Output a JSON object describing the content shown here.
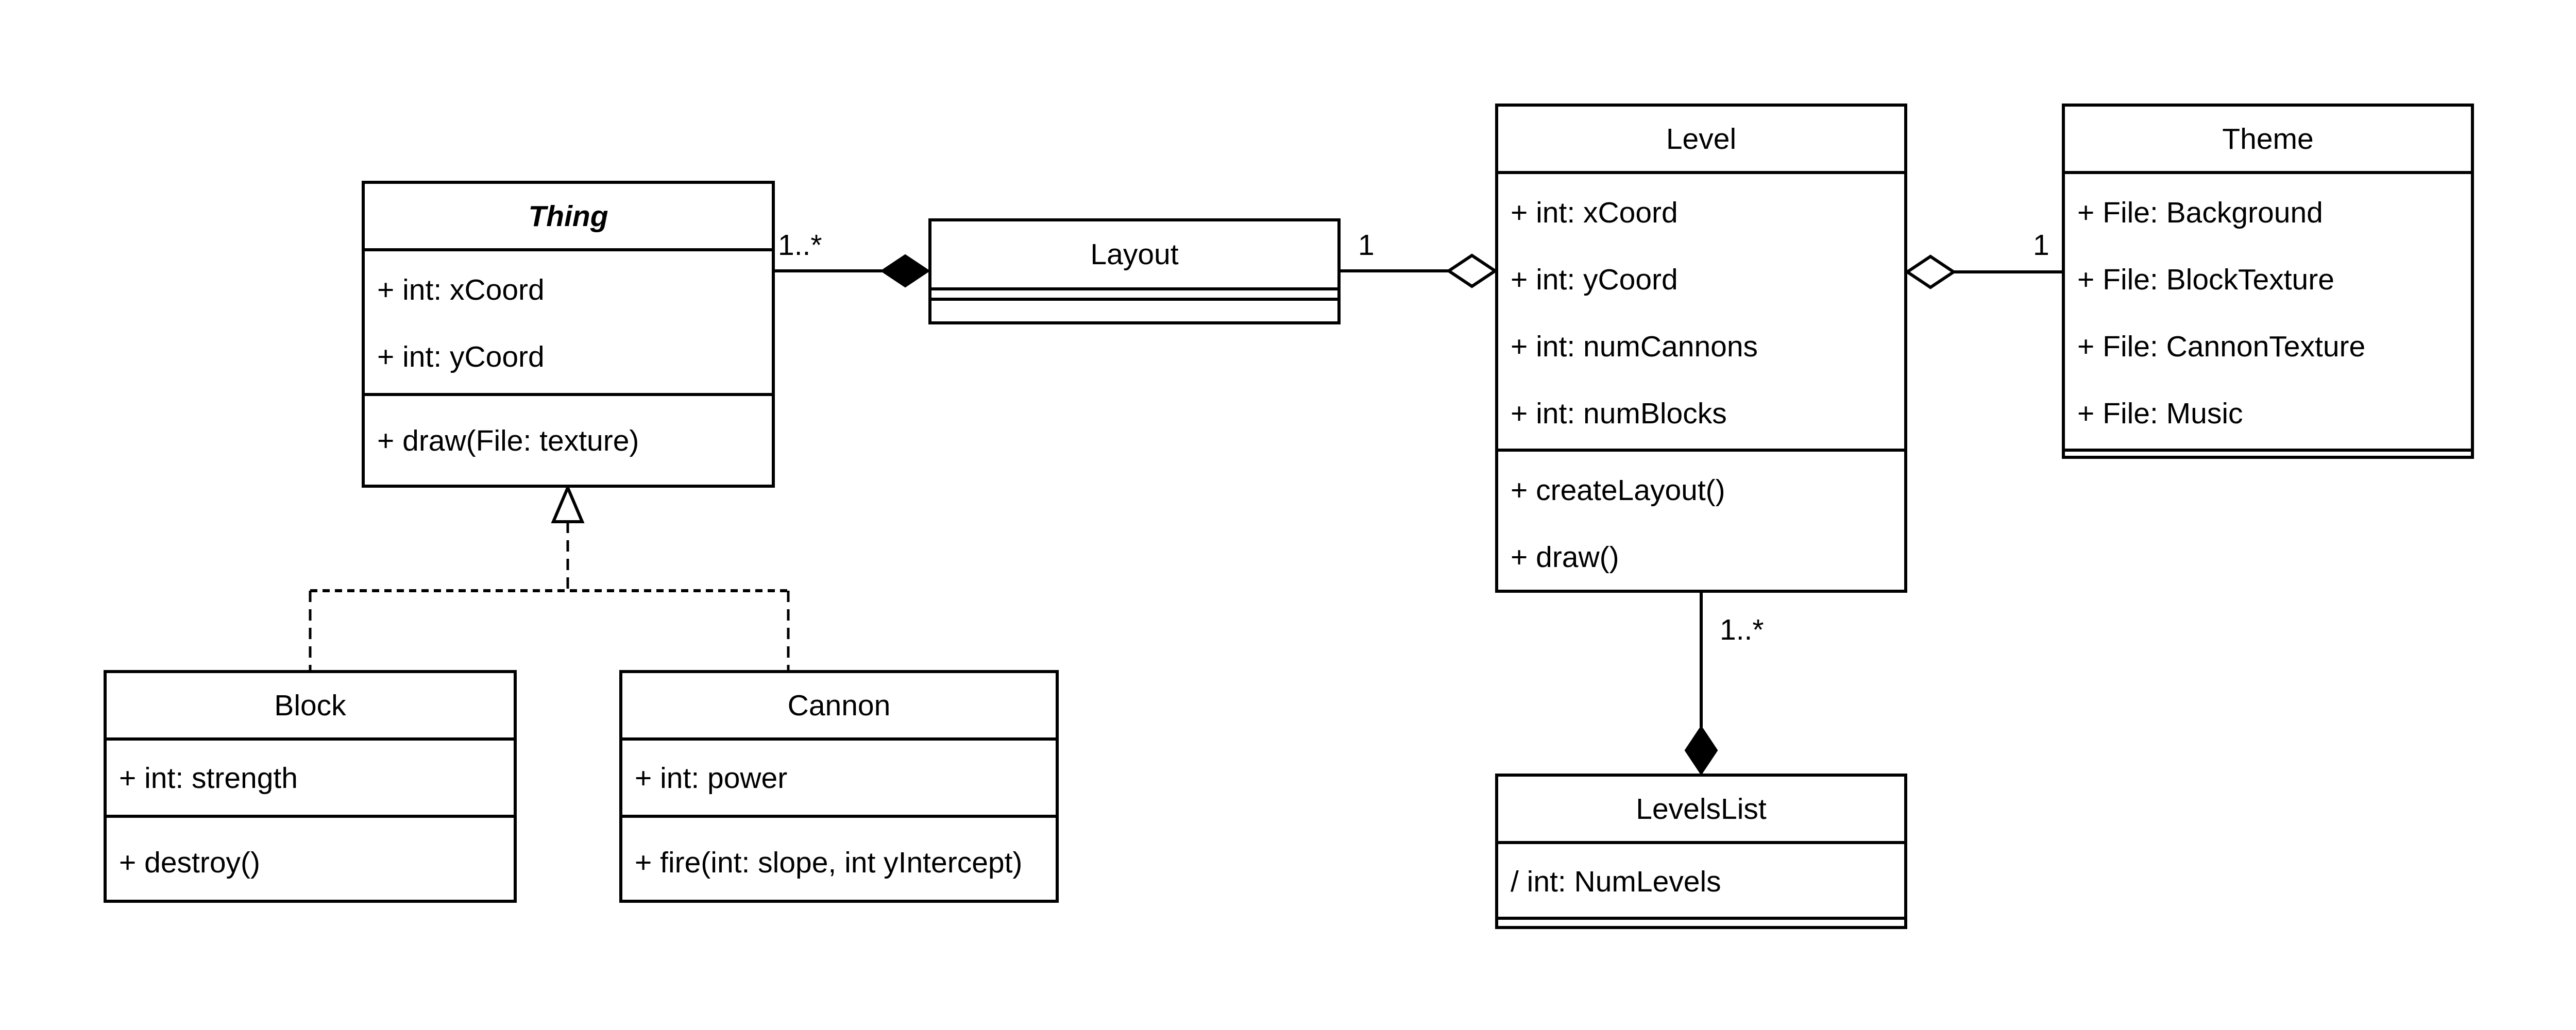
{
  "diagram": {
    "type": "UML class diagram",
    "classes": {
      "thing": {
        "name": "Thing",
        "abstract": true,
        "attributes": [
          "+ int: xCoord",
          "+ int: yCoord"
        ],
        "methods": [
          "+ draw(File: texture)"
        ]
      },
      "layout": {
        "name": "Layout",
        "attributes": [],
        "methods": []
      },
      "level": {
        "name": "Level",
        "attributes": [
          "+ int: xCoord",
          "+ int: yCoord",
          "+ int: numCannons",
          "+ int: numBlocks"
        ],
        "methods": [
          "+ createLayout()",
          "+ draw()"
        ]
      },
      "theme": {
        "name": "Theme",
        "attributes": [
          "+ File: Background",
          "+ File: BlockTexture",
          "+ File: CannonTexture",
          "+ File: Music"
        ],
        "methods": []
      },
      "levelslist": {
        "name": "LevelsList",
        "attributes": [
          "/ int: NumLevels"
        ],
        "methods": []
      },
      "block": {
        "name": "Block",
        "attributes": [
          "+ int: strength"
        ],
        "methods": [
          "+ destroy()"
        ]
      },
      "cannon": {
        "name": "Cannon",
        "attributes": [
          "+ int: power"
        ],
        "methods": [
          "+ fire(int: slope, int yIntercept)"
        ]
      }
    },
    "relationships": [
      {
        "kind": "composition",
        "from": "Thing",
        "to": "Layout",
        "multiplicity_from": "1..*"
      },
      {
        "kind": "aggregation",
        "from": "Layout",
        "to": "Level",
        "multiplicity_from": "1"
      },
      {
        "kind": "aggregation",
        "from": "Theme",
        "to": "Level",
        "multiplicity_from": "1"
      },
      {
        "kind": "composition",
        "from": "Level",
        "to": "LevelsList",
        "multiplicity_from": "1..*"
      },
      {
        "kind": "realization",
        "from": "Block",
        "to": "Thing"
      },
      {
        "kind": "realization",
        "from": "Cannon",
        "to": "Thing"
      }
    ],
    "multiplicities": {
      "thing_layout": "1..*",
      "layout_level": "1",
      "theme_level": "1",
      "level_levelslist": "1..*"
    },
    "colors": {
      "stroke": "#000000",
      "background": "#ffffff"
    }
  }
}
